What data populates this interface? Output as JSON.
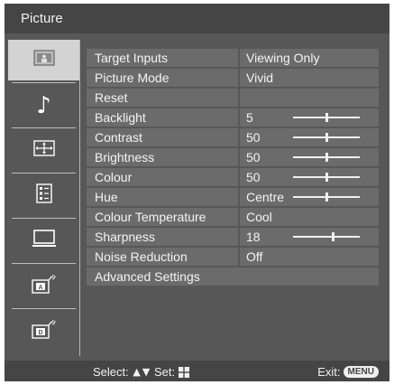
{
  "title": "Picture",
  "sidebar": {
    "items": [
      {
        "icon": "picture-icon",
        "selected": true
      },
      {
        "icon": "sound-note-icon",
        "symbol": "♪",
        "selected": false
      },
      {
        "icon": "screen-adjust-icon",
        "selected": false
      },
      {
        "icon": "setup-list-icon",
        "selected": false
      },
      {
        "icon": "pc-monitor-icon",
        "selected": false
      },
      {
        "icon": "analogue-tuning-icon",
        "badge": "A",
        "selected": false
      },
      {
        "icon": "digital-tuning-icon",
        "badge": "D",
        "selected": false
      }
    ]
  },
  "menu": {
    "rows": [
      {
        "label": "Target Inputs",
        "value": "Viewing Only"
      },
      {
        "label": "Picture Mode",
        "value": "Vivid"
      },
      {
        "label": "Reset",
        "value": ""
      },
      {
        "label": "Backlight",
        "value": "5",
        "slider": 0.5
      },
      {
        "label": "Contrast",
        "value": "50",
        "slider": 0.5
      },
      {
        "label": "Brightness",
        "value": "50",
        "slider": 0.5
      },
      {
        "label": "Colour",
        "value": "50",
        "slider": 0.5
      },
      {
        "label": "Hue",
        "value": "Centre",
        "slider": 0.5
      },
      {
        "label": "Colour Temperature",
        "value": "Cool"
      },
      {
        "label": "Sharpness",
        "value": "18",
        "slider": 0.6
      },
      {
        "label": "Noise Reduction",
        "value": "Off"
      },
      {
        "label": "Advanced Settings",
        "value": "",
        "full": true
      }
    ]
  },
  "footer": {
    "select_label": "Select:",
    "set_label": "Set:",
    "exit_label": "Exit:",
    "menu_button": "MENU",
    "up_arrow": "▲",
    "down_arrow": "▼"
  },
  "colors": {
    "panel": "#575757",
    "bar": "#454545",
    "row": "#6b6b6b",
    "selected_slot": "#d3d3d3",
    "text": "#f4f4f4"
  }
}
